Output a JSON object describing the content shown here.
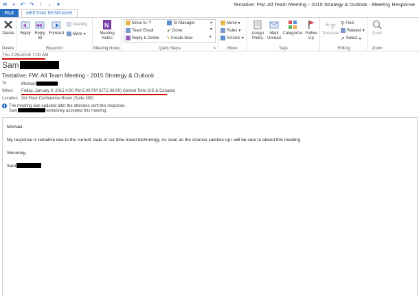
{
  "window": {
    "title": "Tentative: FW: All Team Meeting - 2015 Strategy & Outlook  -  Meeting Response"
  },
  "tabs": {
    "file": "FILE",
    "meeting_response": "MEETING RESPONSE"
  },
  "ribbon": {
    "delete": {
      "label": "Delete",
      "group": "Delete"
    },
    "respond": {
      "reply": "Reply",
      "reply_all": "Reply All",
      "forward": "Forward",
      "meeting": "Meeting",
      "more": "More",
      "group": "Respond"
    },
    "meeting_notes": {
      "label": "Meeting Notes",
      "group": "Meeting Notes"
    },
    "quick_steps": {
      "items": [
        "Move to: ?",
        "Team Email",
        "Reply & Delete",
        "To Manager",
        "Done",
        "Create New"
      ],
      "group": "Quick Steps"
    },
    "move": {
      "move": "Move",
      "rules": "Rules",
      "actions": "Actions",
      "group": "Move"
    },
    "tags": {
      "assign_policy": "Assign Policy",
      "mark_unread": "Mark Unread",
      "categorize": "Categorize",
      "follow_up": "Follow Up",
      "group": "Tags"
    },
    "editing": {
      "translate": "Translate",
      "find": "Find",
      "related": "Related",
      "select": "Select",
      "group": "Editing"
    },
    "zoom": {
      "label": "Zoom",
      "group": "Zoom"
    }
  },
  "header": {
    "received": "Thu 2/25/2016 7:09 AM",
    "sender": "Sam",
    "subject": "Tentative: FW: All Team Meeting - 2015 Strategy & Outlook",
    "to_label": "To",
    "to_value": "Michael",
    "when_label": "When",
    "when_value": "Friday, January 9, 2015 4:00 PM-5:00 PM (UTC-06:00) Central Time (US & Canada)",
    "location_label": "Location",
    "location_value": "3rd Floor Conference Room (Suite 300)",
    "info_line1": "The meeting was updated after the attendee sent this response.",
    "info_line2_prefix": "Sam",
    "info_line2_suffix": "tentatively accepted this meeting."
  },
  "message": {
    "greeting": "Michael,",
    "body": "My response is tentative due to the current state of our time travel technology. As soon as the science catches up I will be sure to attend this meeting.",
    "closing": "Sincerely,",
    "signature": "Sam"
  },
  "colors": {
    "accent": "#2b6fc4",
    "highlight": "#cc0000"
  }
}
